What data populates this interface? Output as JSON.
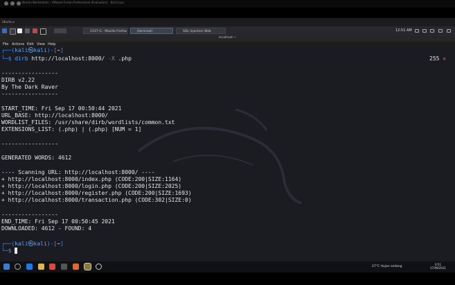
{
  "vm_window": {
    "title": "Ubuntu Workstation - VMware Fusion Professional (Evaluation) - Kali Linux"
  },
  "vm_toolbar": {
    "label": "Ubuntu ▾"
  },
  "panel": {
    "tasks": [
      {
        "label": "1337-G - Mozilla Firefox"
      },
      {
        "label": "[terminal]"
      },
      {
        "label": "SQL Injection Web"
      }
    ],
    "clock": "12:51 AM"
  },
  "terminal": {
    "window_title": "localhost:~",
    "menu": [
      "File",
      "Actions",
      "Edit",
      "View",
      "Help"
    ],
    "prompt_user": "kali",
    "prompt_host": "kali",
    "prompt_dir": "~",
    "command_name": "dirb",
    "command_args": "http://localhost:8000/",
    "command_flag": "-X",
    "command_ext": ".php",
    "exit_code": "255",
    "exit_symbol": "✕",
    "output": {
      "sep1": "-----------------",
      "version": "DIRB v2.22",
      "author": "By The Dark Raver",
      "sep2": "-----------------",
      "start_time": "START_TIME: Fri Sep 17 00:50:44 2021",
      "url_base": "URL_BASE: http://localhost:8000/",
      "wordlist": "WORDLIST_FILES: /usr/share/dirb/wordlists/common.txt",
      "extensions": "EXTENSIONS_LIST: (.php) | (.php) [NUM = 1]",
      "sep3": "-----------------",
      "generated": "GENERATED WORDS: 4612",
      "scanning": "---- Scanning URL: http://localhost:8000/ ----",
      "results": [
        "+ http://localhost:8000/index.php (CODE:200|SIZE:1164)",
        "+ http://localhost:8000/login.php (CODE:200|SIZE:2025)",
        "+ http://localhost:8000/register.php (CODE:200|SIZE:1693)",
        "+ http://localhost:8000/transaction.php (CODE:302|SIZE:0)"
      ],
      "sep4": "-----------------",
      "end_time": "END_TIME: Fri Sep 17 00:50:45 2021",
      "downloaded": "DOWNLOADED: 4612 - FOUND: 4"
    }
  },
  "windows_taskbar": {
    "weather": "27°C  Hujan sedang",
    "time": "0:51",
    "date": "17/09/2021"
  },
  "colors": {
    "terminal_bg": "#1a1c22",
    "prompt_blue": "#3b8ef3",
    "exit_red": "#ff5c57"
  }
}
